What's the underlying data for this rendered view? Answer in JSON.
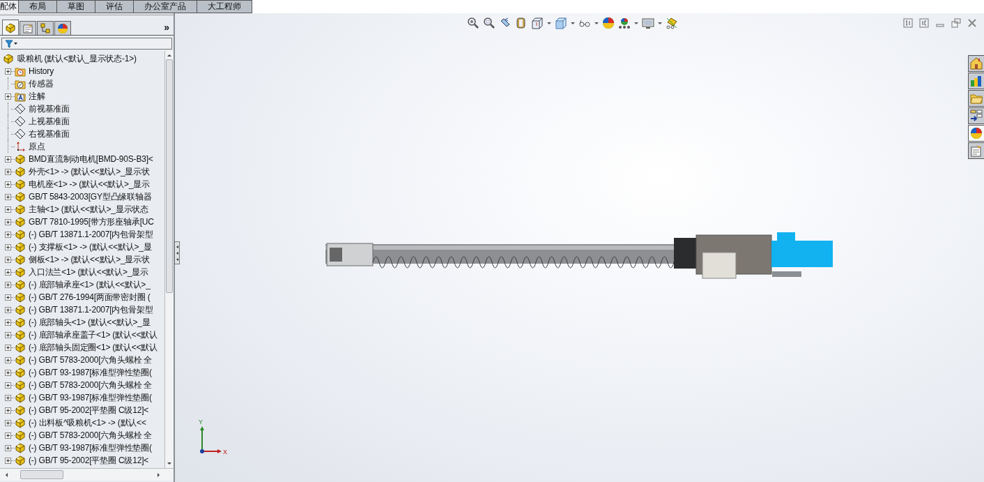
{
  "tabs": [
    {
      "label": "配体",
      "selected": true
    },
    {
      "label": "布局",
      "selected": false
    },
    {
      "label": "草图",
      "selected": false
    },
    {
      "label": "评估",
      "selected": false
    },
    {
      "label": "办公室产品",
      "selected": false
    },
    {
      "label": "大工程师",
      "selected": false
    }
  ],
  "panel_tabs": [
    {
      "kind": "feature-tree",
      "selected": true
    },
    {
      "kind": "property",
      "selected": false
    },
    {
      "kind": "config",
      "selected": false
    },
    {
      "kind": "display",
      "selected": false
    }
  ],
  "panel_more": "»",
  "tree": {
    "label": "吸粮机  (默认<默认_显示状态-1>)",
    "children": [
      {
        "kind": "history",
        "label": "History",
        "expandable": true
      },
      {
        "kind": "sensor",
        "label": "传感器",
        "expandable": false
      },
      {
        "kind": "annotation",
        "label": "注解",
        "expandable": true
      },
      {
        "kind": "plane",
        "label": "前视基准面",
        "expandable": false
      },
      {
        "kind": "plane",
        "label": "上视基准面",
        "expandable": false
      },
      {
        "kind": "plane",
        "label": "右视基准面",
        "expandable": false
      },
      {
        "kind": "origin",
        "label": "原点",
        "expandable": false
      },
      {
        "kind": "part",
        "label": "BMD直流制动电机[BMD-90S-B3]<",
        "expandable": true
      },
      {
        "kind": "part",
        "label": "外壳<1> -> (默认<<默认>_显示状",
        "expandable": true
      },
      {
        "kind": "part",
        "label": "电机座<1> -> (默认<<默认>_显示",
        "expandable": true
      },
      {
        "kind": "part",
        "label": "GB/T 5843-2003[GY型凸缘联轴器",
        "expandable": true
      },
      {
        "kind": "part",
        "label": "主轴<1> (默认<<默认>_显示状态",
        "expandable": true
      },
      {
        "kind": "part",
        "label": "GB/T 7810-1995[带方形座轴承[UC",
        "expandable": true
      },
      {
        "kind": "part",
        "label": "(-) GB/T 13871.1-2007[内包骨架型",
        "expandable": true
      },
      {
        "kind": "part",
        "label": "(-) 支撑板<1> -> (默认<<默认>_显",
        "expandable": true
      },
      {
        "kind": "part",
        "label": "侧板<1> -> (默认<<默认>_显示状",
        "expandable": true
      },
      {
        "kind": "part",
        "label": "入口法兰<1> (默认<<默认>_显示",
        "expandable": true
      },
      {
        "kind": "part",
        "label": "(-) 底部轴承座<1> (默认<<默认>_",
        "expandable": true
      },
      {
        "kind": "part",
        "label": "(-) GB/T 276-1994[两面带密封圈 (",
        "expandable": true
      },
      {
        "kind": "part",
        "label": "(-) GB/T 13871.1-2007[内包骨架型",
        "expandable": true
      },
      {
        "kind": "part",
        "label": "(-) 底部轴头<1> (默认<<默认>_显",
        "expandable": true
      },
      {
        "kind": "part",
        "label": "(-) 底部轴承座盖子<1> (默认<<默认",
        "expandable": true
      },
      {
        "kind": "part",
        "label": "(-) 底部轴头固定圈<1> (默认<<默认",
        "expandable": true
      },
      {
        "kind": "part",
        "label": "(-) GB/T 5783-2000[六角头螺栓 全",
        "expandable": true
      },
      {
        "kind": "part",
        "label": "(-) GB/T 93-1987[标准型弹性垫圈(",
        "expandable": true
      },
      {
        "kind": "part",
        "label": "(-) GB/T 5783-2000[六角头螺栓 全",
        "expandable": true
      },
      {
        "kind": "part",
        "label": "(-) GB/T 93-1987[标准型弹性垫圈(",
        "expandable": true
      },
      {
        "kind": "part",
        "label": "(-) GB/T 95-2002[平垫圈 C级12]<",
        "expandable": true
      },
      {
        "kind": "part",
        "label": "(-) 出料板^吸粮机<1> -> (默认<<",
        "expandable": true
      },
      {
        "kind": "part",
        "label": "(-) GB/T 5783-2000[六角头螺栓 全",
        "expandable": true
      },
      {
        "kind": "part",
        "label": "(-) GB/T 93-1987[标准型弹性垫圈(",
        "expandable": true
      },
      {
        "kind": "part",
        "label": "(-) GB/T 95-2002[平垫圈 C级12]<",
        "expandable": true
      }
    ]
  },
  "task_pane": [
    {
      "kind": "home",
      "selected": false
    },
    {
      "kind": "library",
      "selected": false
    },
    {
      "kind": "folder",
      "selected": false
    },
    {
      "kind": "palette",
      "selected": false
    },
    {
      "kind": "appearance",
      "selected": true
    },
    {
      "kind": "properties",
      "selected": false
    }
  ],
  "triad": {
    "y_label": "Y",
    "x_label": "X"
  }
}
